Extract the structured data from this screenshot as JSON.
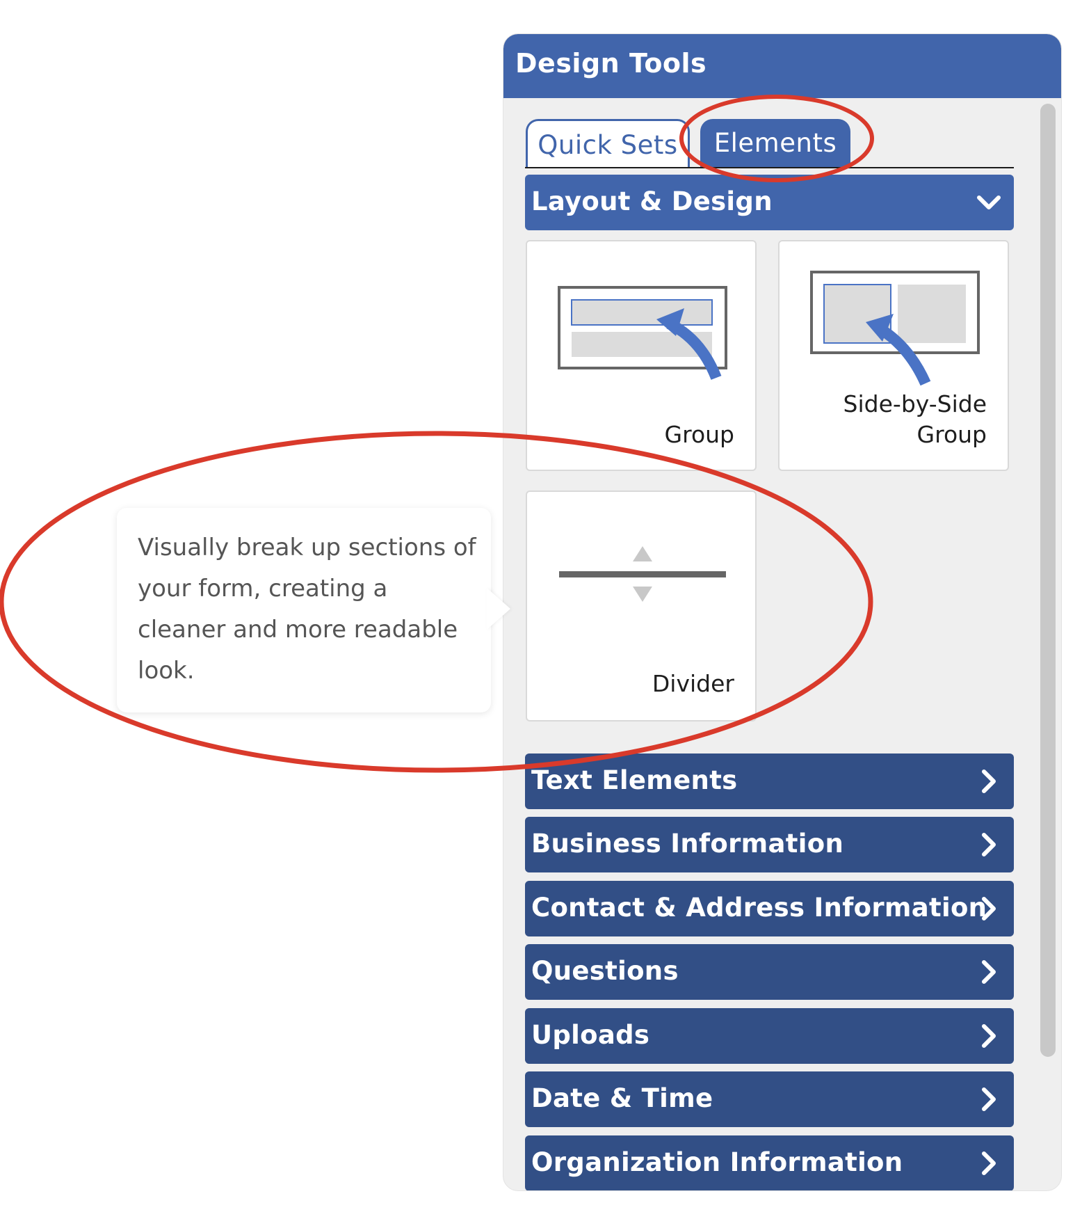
{
  "panel": {
    "title": "Design Tools"
  },
  "tabs": [
    {
      "label": "Quick Sets"
    },
    {
      "label": "Elements"
    }
  ],
  "layout_section": {
    "label": "Layout & Design",
    "icon": "chevron-down-icon"
  },
  "cards": [
    {
      "label": "Group",
      "icon": "group-icon"
    },
    {
      "label_line1": "Side-by-Side",
      "label_line2": "Group",
      "icon": "side-by-side-group-icon"
    },
    {
      "label": "Divider",
      "icon": "divider-icon"
    }
  ],
  "tooltip": {
    "text": "Visually break up sections of your form, creating a cleaner and more readable look."
  },
  "sections": [
    {
      "label": "Text Elements"
    },
    {
      "label": "Business Information"
    },
    {
      "label": "Contact & Address Information"
    },
    {
      "label": "Questions"
    },
    {
      "label": "Uploads"
    },
    {
      "label": "Date & Time"
    },
    {
      "label": "Organization Information"
    }
  ],
  "colors": {
    "header_blue": "#4165ab",
    "section_blue": "#324f86",
    "annotation_red": "#d93a2b"
  }
}
